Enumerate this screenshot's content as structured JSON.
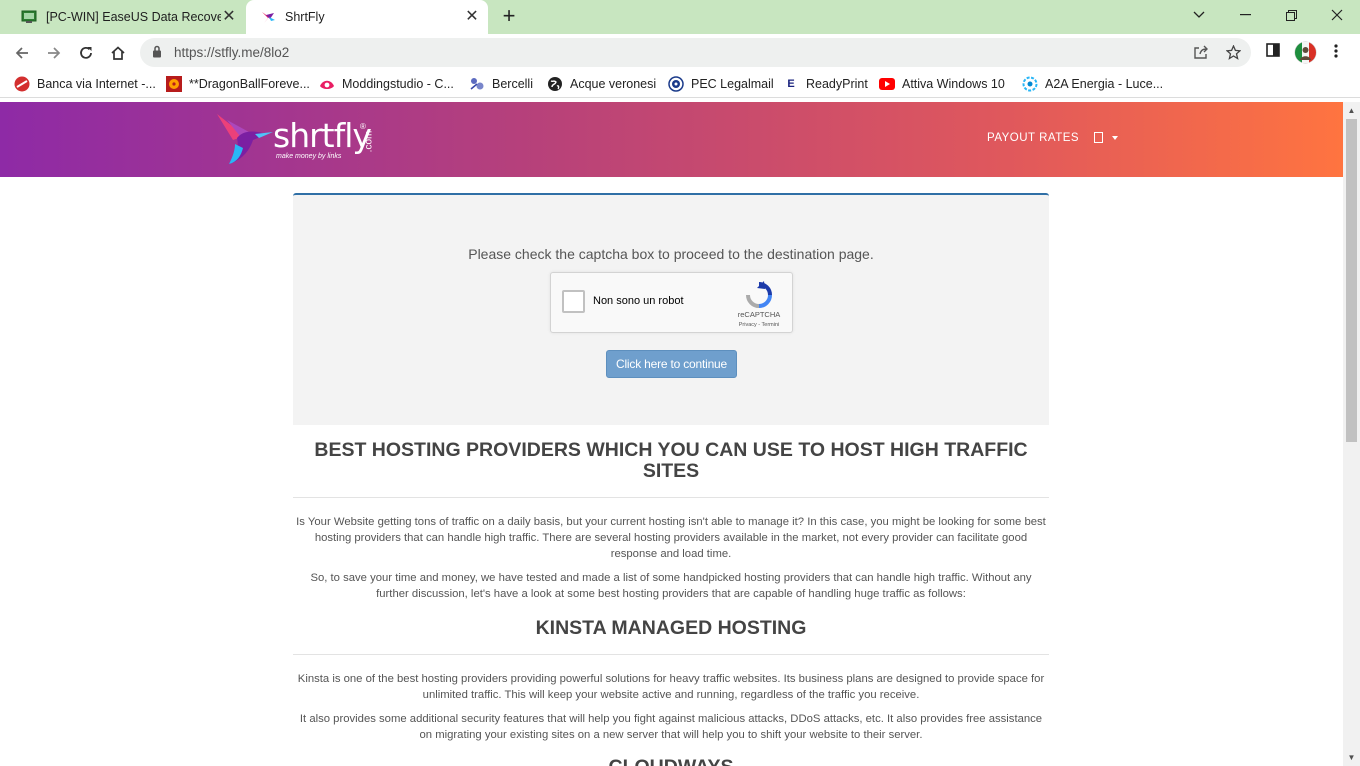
{
  "browser": {
    "tabs": [
      {
        "title": "[PC-WIN] EaseUS Data Recovery",
        "active": false
      },
      {
        "title": "ShrtFly",
        "active": true
      }
    ],
    "url": "https://stfly.me/8lo2",
    "bookmarks": [
      {
        "label": "Banca via Internet -...",
        "icon": "bank-icon"
      },
      {
        "label": "**DragonBallForeve...",
        "icon": "dragonball-icon"
      },
      {
        "label": "Moddingstudio - C...",
        "icon": "moddingstudio-icon"
      },
      {
        "label": "Bercelli",
        "icon": "bercelli-icon"
      },
      {
        "label": "Acque veronesi",
        "icon": "globe-icon"
      },
      {
        "label": "PEC Legalmail",
        "icon": "legalmail-icon"
      },
      {
        "label": "ReadyPrint",
        "icon": "readyprint-icon"
      },
      {
        "label": "Attiva Windows 10",
        "icon": "youtube-icon"
      },
      {
        "label": "A2A Energia - Luce...",
        "icon": "a2a-icon"
      }
    ]
  },
  "header": {
    "logo_text": "shrtfly",
    "logo_tagline": "make money by links",
    "logo_domain": ".com",
    "logo_reg": "®",
    "nav_payout": "PAYOUT RATES"
  },
  "captcha": {
    "message": "Please check the captcha box to proceed to the destination page.",
    "checkbox_label": "Non sono un robot",
    "brand": "reCAPTCHA",
    "links": "Privacy - Termini",
    "continue_label": "Click here to continue"
  },
  "article": {
    "heading1": "BEST HOSTING PROVIDERS WHICH YOU CAN USE TO HOST HIGH TRAFFIC SITES",
    "p1": "Is Your Website getting tons of traffic on a daily basis, but your current hosting isn't able to manage it? In this case, you might be looking for some best hosting providers that can handle high traffic. There are several hosting providers available in the market, not every provider can facilitate good response and load time.",
    "p2": "So, to save your time and money, we have tested and made a list of some handpicked hosting providers that can handle high traffic. Without any further discussion, let's have a look at some best hosting providers that are capable of handling huge traffic as follows:",
    "heading2": "KINSTA MANAGED HOSTING",
    "p3": "Kinsta is one of the best hosting providers providing powerful solutions for heavy traffic websites. Its business plans are designed to provide space for unlimited traffic. This will keep your website active and running, regardless of the traffic you receive.",
    "p4": "It also provides some additional security features that will help you fight against malicious attacks, DDoS attacks, etc. It also provides free assistance on migrating your existing sites on a new server that will help you to shift your website to their server.",
    "heading3": "CLOUDWAYS"
  }
}
